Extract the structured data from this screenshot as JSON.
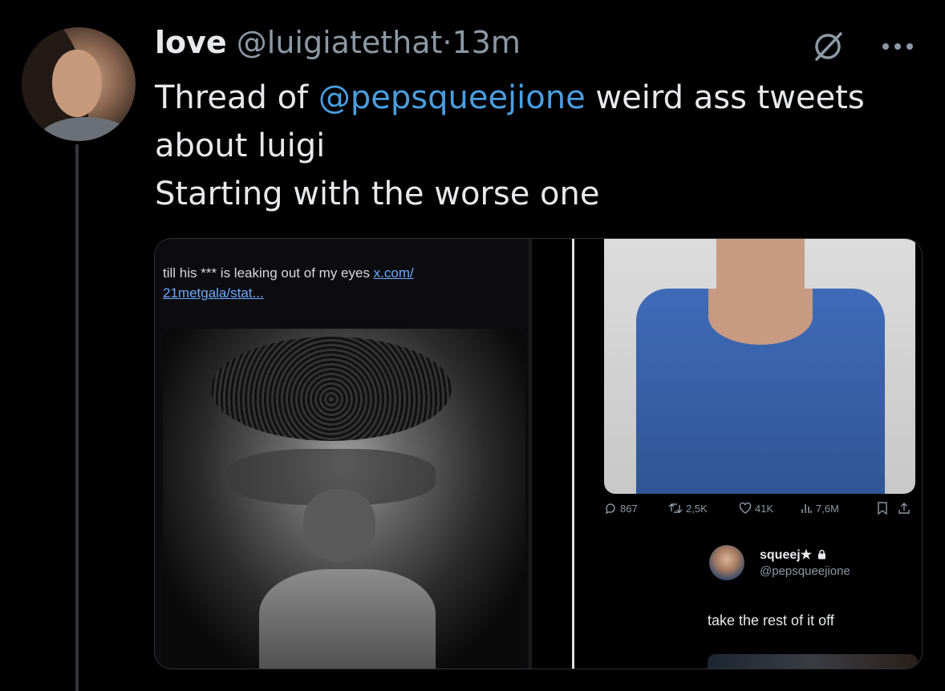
{
  "author": {
    "name": "love",
    "handle": "@luigiatethat",
    "separator": "·",
    "time": "13m"
  },
  "tweet": {
    "text_before": "Thread of ",
    "mention": "@pepsqueejione",
    "text_after": " weird ass tweets about luigi",
    "line2": "Starting with the worse one"
  },
  "icons": {
    "grok": "grok-icon",
    "more": "more-icon"
  },
  "media": {
    "left": {
      "caption": "till his *** is leaking out of my eyes ",
      "link": "x.com/ 21metgala/stat..."
    },
    "right": {
      "stats": {
        "replies": "867",
        "reposts": "2,5K",
        "likes": "41K",
        "views": "7,6M"
      },
      "reply": {
        "name": "squeej★",
        "handle": "@pepsqueejione",
        "text": "take the rest of it off"
      }
    }
  },
  "colors": {
    "background": "#000000",
    "mention": "#4a9ee0",
    "secondary_text": "#8b98a5",
    "vest": "#3f6bb8"
  }
}
